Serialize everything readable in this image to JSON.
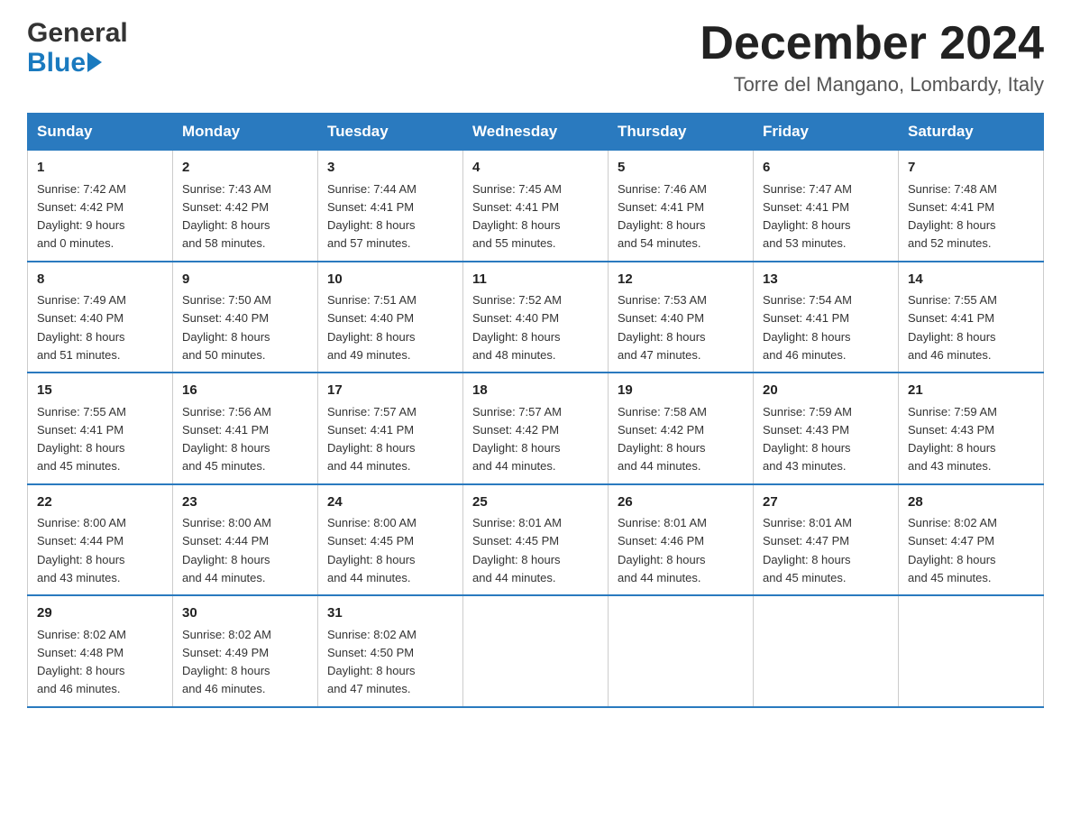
{
  "header": {
    "title": "December 2024",
    "subtitle": "Torre del Mangano, Lombardy, Italy",
    "logo_general": "General",
    "logo_blue": "Blue"
  },
  "days_of_week": [
    "Sunday",
    "Monday",
    "Tuesday",
    "Wednesday",
    "Thursday",
    "Friday",
    "Saturday"
  ],
  "weeks": [
    [
      {
        "day": "1",
        "info": "Sunrise: 7:42 AM\nSunset: 4:42 PM\nDaylight: 9 hours\nand 0 minutes."
      },
      {
        "day": "2",
        "info": "Sunrise: 7:43 AM\nSunset: 4:42 PM\nDaylight: 8 hours\nand 58 minutes."
      },
      {
        "day": "3",
        "info": "Sunrise: 7:44 AM\nSunset: 4:41 PM\nDaylight: 8 hours\nand 57 minutes."
      },
      {
        "day": "4",
        "info": "Sunrise: 7:45 AM\nSunset: 4:41 PM\nDaylight: 8 hours\nand 55 minutes."
      },
      {
        "day": "5",
        "info": "Sunrise: 7:46 AM\nSunset: 4:41 PM\nDaylight: 8 hours\nand 54 minutes."
      },
      {
        "day": "6",
        "info": "Sunrise: 7:47 AM\nSunset: 4:41 PM\nDaylight: 8 hours\nand 53 minutes."
      },
      {
        "day": "7",
        "info": "Sunrise: 7:48 AM\nSunset: 4:41 PM\nDaylight: 8 hours\nand 52 minutes."
      }
    ],
    [
      {
        "day": "8",
        "info": "Sunrise: 7:49 AM\nSunset: 4:40 PM\nDaylight: 8 hours\nand 51 minutes."
      },
      {
        "day": "9",
        "info": "Sunrise: 7:50 AM\nSunset: 4:40 PM\nDaylight: 8 hours\nand 50 minutes."
      },
      {
        "day": "10",
        "info": "Sunrise: 7:51 AM\nSunset: 4:40 PM\nDaylight: 8 hours\nand 49 minutes."
      },
      {
        "day": "11",
        "info": "Sunrise: 7:52 AM\nSunset: 4:40 PM\nDaylight: 8 hours\nand 48 minutes."
      },
      {
        "day": "12",
        "info": "Sunrise: 7:53 AM\nSunset: 4:40 PM\nDaylight: 8 hours\nand 47 minutes."
      },
      {
        "day": "13",
        "info": "Sunrise: 7:54 AM\nSunset: 4:41 PM\nDaylight: 8 hours\nand 46 minutes."
      },
      {
        "day": "14",
        "info": "Sunrise: 7:55 AM\nSunset: 4:41 PM\nDaylight: 8 hours\nand 46 minutes."
      }
    ],
    [
      {
        "day": "15",
        "info": "Sunrise: 7:55 AM\nSunset: 4:41 PM\nDaylight: 8 hours\nand 45 minutes."
      },
      {
        "day": "16",
        "info": "Sunrise: 7:56 AM\nSunset: 4:41 PM\nDaylight: 8 hours\nand 45 minutes."
      },
      {
        "day": "17",
        "info": "Sunrise: 7:57 AM\nSunset: 4:41 PM\nDaylight: 8 hours\nand 44 minutes."
      },
      {
        "day": "18",
        "info": "Sunrise: 7:57 AM\nSunset: 4:42 PM\nDaylight: 8 hours\nand 44 minutes."
      },
      {
        "day": "19",
        "info": "Sunrise: 7:58 AM\nSunset: 4:42 PM\nDaylight: 8 hours\nand 44 minutes."
      },
      {
        "day": "20",
        "info": "Sunrise: 7:59 AM\nSunset: 4:43 PM\nDaylight: 8 hours\nand 43 minutes."
      },
      {
        "day": "21",
        "info": "Sunrise: 7:59 AM\nSunset: 4:43 PM\nDaylight: 8 hours\nand 43 minutes."
      }
    ],
    [
      {
        "day": "22",
        "info": "Sunrise: 8:00 AM\nSunset: 4:44 PM\nDaylight: 8 hours\nand 43 minutes."
      },
      {
        "day": "23",
        "info": "Sunrise: 8:00 AM\nSunset: 4:44 PM\nDaylight: 8 hours\nand 44 minutes."
      },
      {
        "day": "24",
        "info": "Sunrise: 8:00 AM\nSunset: 4:45 PM\nDaylight: 8 hours\nand 44 minutes."
      },
      {
        "day": "25",
        "info": "Sunrise: 8:01 AM\nSunset: 4:45 PM\nDaylight: 8 hours\nand 44 minutes."
      },
      {
        "day": "26",
        "info": "Sunrise: 8:01 AM\nSunset: 4:46 PM\nDaylight: 8 hours\nand 44 minutes."
      },
      {
        "day": "27",
        "info": "Sunrise: 8:01 AM\nSunset: 4:47 PM\nDaylight: 8 hours\nand 45 minutes."
      },
      {
        "day": "28",
        "info": "Sunrise: 8:02 AM\nSunset: 4:47 PM\nDaylight: 8 hours\nand 45 minutes."
      }
    ],
    [
      {
        "day": "29",
        "info": "Sunrise: 8:02 AM\nSunset: 4:48 PM\nDaylight: 8 hours\nand 46 minutes."
      },
      {
        "day": "30",
        "info": "Sunrise: 8:02 AM\nSunset: 4:49 PM\nDaylight: 8 hours\nand 46 minutes."
      },
      {
        "day": "31",
        "info": "Sunrise: 8:02 AM\nSunset: 4:50 PM\nDaylight: 8 hours\nand 47 minutes."
      },
      {
        "day": "",
        "info": ""
      },
      {
        "day": "",
        "info": ""
      },
      {
        "day": "",
        "info": ""
      },
      {
        "day": "",
        "info": ""
      }
    ]
  ]
}
